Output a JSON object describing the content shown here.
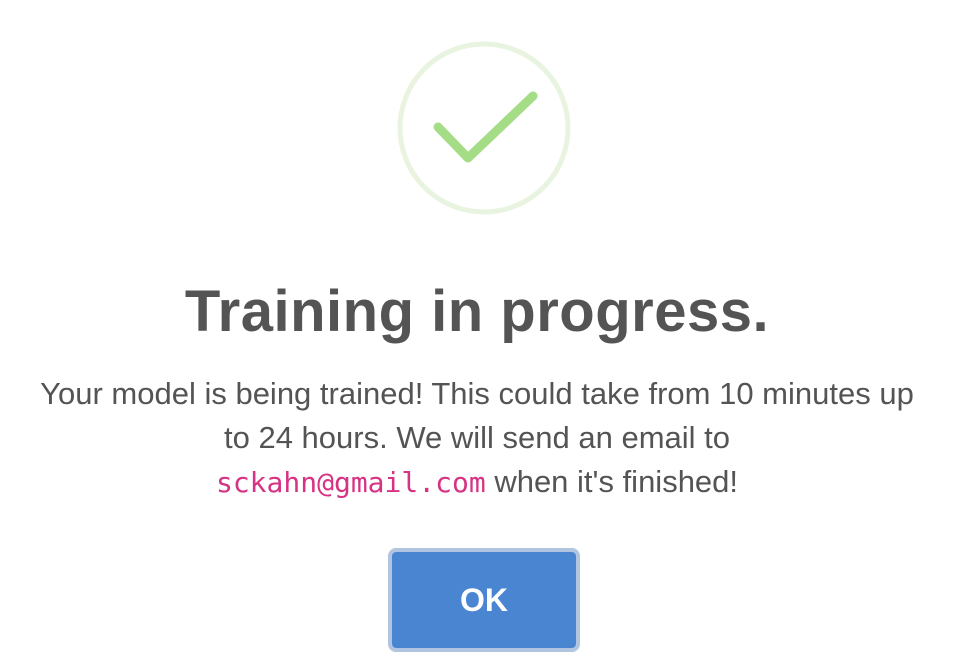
{
  "dialog": {
    "icon": "success-check-icon",
    "title": "Training in progress.",
    "message_part1": "Your model is being trained! This could take from 10 minutes up to 24 hours. We will send an email to",
    "email": "sckahn@gmail.com",
    "message_part2": "when it's finished!",
    "ok_label": "OK"
  },
  "colors": {
    "title_text": "#545454",
    "email_text": "#d63384",
    "button_bg": "#4a85d1",
    "button_focus_ring": "#b2c5e0",
    "icon_ring": "#e8f4e0",
    "icon_check": "#a5dc86"
  }
}
